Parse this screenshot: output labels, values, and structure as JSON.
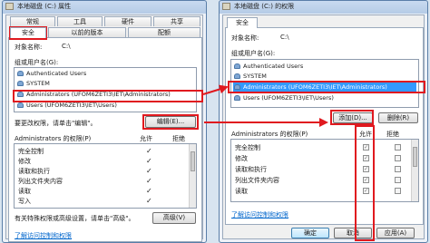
{
  "left": {
    "title": "本地磁盘 (C:) 属性",
    "tabs_row1": [
      "常规",
      "工具",
      "硬件",
      "共享"
    ],
    "tabs_row2": [
      "安全",
      "以前的版本",
      "配额"
    ],
    "object_label": "对象名称:",
    "object_value": "C:\\",
    "groups_label": "组或用户名(G):",
    "users": [
      "Authenticated Users",
      "SYSTEM",
      "Administrators (UFOM6ZETI3\\IET\\Administrators)",
      "Users (UFOM6ZETI3\\IET\\Users)"
    ],
    "change_text": "要更改权限，请单击\"编辑\"。",
    "edit_button": "编辑(E)...",
    "perm_label": "Administrators 的权限(P)",
    "allow": "允许",
    "deny": "拒绝",
    "perms": [
      "完全控制",
      "修改",
      "读取和执行",
      "列出文件夹内容",
      "读取",
      "写入"
    ],
    "special_text": "有关特殊权限或高级设置，请单击\"高级\"。",
    "advanced_button": "高级(V)",
    "link": "了解访问控制和权限"
  },
  "right": {
    "title": "本地磁盘 (C:) 的权限",
    "tab": "安全",
    "object_label": "对象名称:",
    "object_value": "C:\\",
    "groups_label": "组或用户名(G):",
    "users": [
      "Authenticated Users",
      "SYSTEM",
      "Administrators (UFOM6ZETI3\\IET\\Administrators)",
      "Users (UFOM6ZETI3\\IET\\Users)"
    ],
    "add_button": "添加(D)...",
    "remove_button": "删除(R)",
    "perm_label": "Administrators 的权限(P)",
    "allow": "允许",
    "deny": "拒绝",
    "perms": [
      "完全控制",
      "修改",
      "读取和执行",
      "列出文件夹内容",
      "读取"
    ],
    "link": "了解访问控制和权限",
    "ok_button": "确定",
    "cancel_button": "取消",
    "apply_button": "应用(A)"
  },
  "colors": {
    "highlight": "#3399ff",
    "annotation": "#e0191f",
    "link": "#0066cc"
  }
}
